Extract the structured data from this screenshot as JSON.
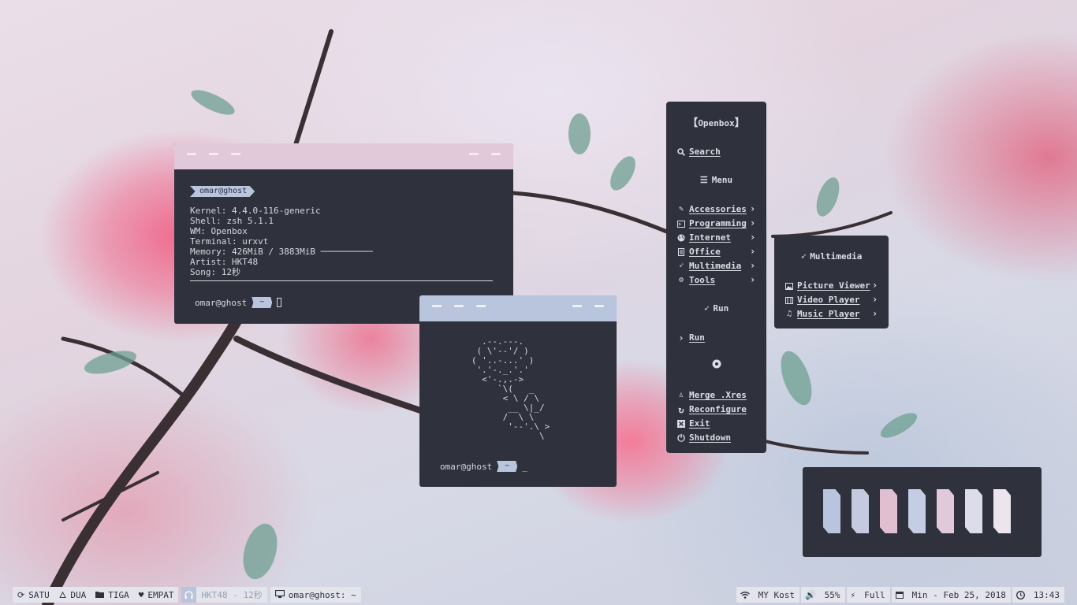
{
  "terminal1": {
    "prompt_badge": "omar@ghost",
    "info": [
      {
        "key": "Kernel",
        "value": "4.4.0-116-generic"
      },
      {
        "key": "Shell",
        "value": "zsh 5.1.1"
      },
      {
        "key": "WM",
        "value": "Openbox"
      },
      {
        "key": "Terminal",
        "value": "urxvt"
      },
      {
        "key": "Memory",
        "value": "426MiB / 3883MiB ──────────"
      },
      {
        "key": "Artist",
        "value": "HKT48"
      },
      {
        "key": "Song",
        "value": "12秒"
      }
    ],
    "prompt_user": "omar@ghost",
    "prompt_dir": "~",
    "bar_color": "#e2c9da"
  },
  "terminal2": {
    "ascii_art": [
      "     .--.---.",
      "    ( \\'--'/ )",
      "   ( '..-...' )",
      "    '.'-._.'.'",
      "     <'-.,.->",
      "        `\\(   _",
      "         < \\ / \\",
      "          __ \\|_/",
      "         /  \\ \\",
      "          '--'.\\ >",
      "                \\"
    ],
    "prompt_user": "omar@ghost",
    "prompt_dir": "~",
    "cursor": "_",
    "bar_color": "#b9c4dd"
  },
  "openbox_menu": {
    "title": "Openbox",
    "search": "Search",
    "menu_heading": "Menu",
    "items": [
      {
        "label": "Accessories",
        "icon": "wand-icon"
      },
      {
        "label": "Programming",
        "icon": "terminal-icon"
      },
      {
        "label": "Internet",
        "icon": "globe-icon"
      },
      {
        "label": "Office",
        "icon": "document-icon"
      },
      {
        "label": "Multimedia",
        "icon": "rocket-icon"
      },
      {
        "label": "Tools",
        "icon": "cogs-icon"
      }
    ],
    "run_heading": "Run",
    "run_item": "Run",
    "system_items": [
      {
        "label": "Merge .Xres",
        "icon": "linux-icon"
      },
      {
        "label": "Reconfigure",
        "icon": "refresh-icon"
      },
      {
        "label": "Exit",
        "icon": "close-box-icon"
      },
      {
        "label": "Shutdown",
        "icon": "power-icon"
      }
    ]
  },
  "multimedia_menu": {
    "title": "Multimedia",
    "items": [
      {
        "label": "Picture Viewer",
        "icon": "image-icon"
      },
      {
        "label": "Video Player",
        "icon": "film-icon"
      },
      {
        "label": "Music Player",
        "icon": "music-icon"
      }
    ]
  },
  "workspaces_widget": {
    "colors": [
      "#b9c4dd",
      "#c6cadf",
      "#e2bed1",
      "#c4cde3",
      "#e2c9da",
      "#dcdceb",
      "#ece6ec"
    ]
  },
  "taskbar": {
    "workspaces": [
      {
        "label": "SATU",
        "icon": "sync-icon"
      },
      {
        "label": "DUA",
        "icon": "fire-icon"
      },
      {
        "label": "TIGA",
        "icon": "folder-icon"
      },
      {
        "label": "EMPAT",
        "icon": "heartbeat-icon"
      }
    ],
    "now_playing": "HKT48 - 12秒",
    "window_title": "omar@ghost: ~",
    "wifi": "MY Kost",
    "volume": "55%",
    "battery": "Full",
    "date": "Min - Feb 25, 2018",
    "time": "13:43"
  }
}
